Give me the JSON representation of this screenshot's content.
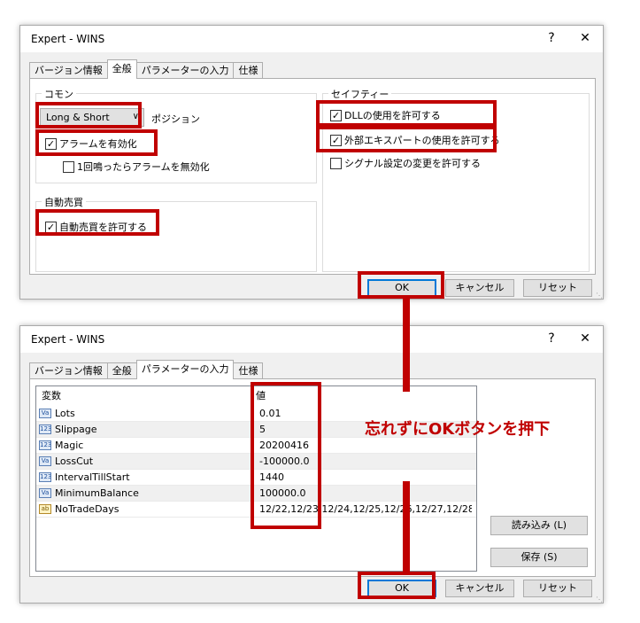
{
  "window1": {
    "title": "Expert - WINS",
    "help": "?",
    "close": "✕",
    "tabs": [
      "バージョン情報",
      "全般",
      "パラメーターの入力",
      "仕様"
    ],
    "active_tab": "全般",
    "common_group": {
      "label": "コモン",
      "position_select": "Long & Short",
      "position_label": "ポジション",
      "alert_enable": {
        "label": "アラームを有効化",
        "checked": true
      },
      "alert_once": {
        "label": "1回鳴ったらアラームを無効化",
        "checked": false
      }
    },
    "trade_group": {
      "label": "自動売買",
      "allow_trade": {
        "label": "自動売買を許可する",
        "checked": true
      }
    },
    "safety_group": {
      "label": "セイフティー",
      "allow_dll": {
        "label": "DLLの使用を許可する",
        "checked": true
      },
      "allow_external": {
        "label": "外部エキスパートの使用を許可する",
        "checked": true
      },
      "allow_signal": {
        "label": "シグナル設定の変更を許可する",
        "checked": false
      }
    },
    "buttons": {
      "ok": "OK",
      "cancel": "キャンセル",
      "reset": "リセット"
    }
  },
  "window2": {
    "title": "Expert - WINS",
    "help": "?",
    "close": "✕",
    "tabs": [
      "バージョン情報",
      "全般",
      "パラメーターの入力",
      "仕様"
    ],
    "active_tab": "パラメーターの入力",
    "columns": {
      "variable": "変数",
      "value": "値"
    },
    "params": [
      {
        "icon": "Va",
        "name": "Lots",
        "value": "0.01"
      },
      {
        "icon": "123",
        "name": "Slippage",
        "value": "5"
      },
      {
        "icon": "123",
        "name": "Magic",
        "value": "20200416"
      },
      {
        "icon": "Va",
        "name": "LossCut",
        "value": "-100000.0"
      },
      {
        "icon": "123",
        "name": "IntervalTillStart",
        "value": "1440"
      },
      {
        "icon": "Va",
        "name": "MinimumBalance",
        "value": "100000.0"
      },
      {
        "icon": "ab",
        "name": "NoTradeDays",
        "value": "12/22,12/23,12/24,12/25,12/26,12/27,12/28,12/2..."
      }
    ],
    "buttons": {
      "load": "読み込み (L)",
      "save": "保存 (S)",
      "ok": "OK",
      "cancel": "キャンセル",
      "reset": "リセット"
    }
  },
  "annotation": {
    "text": "忘れずにOKボタンを押下"
  },
  "colors": {
    "highlight": "#c00000",
    "focus": "#0078d7"
  }
}
